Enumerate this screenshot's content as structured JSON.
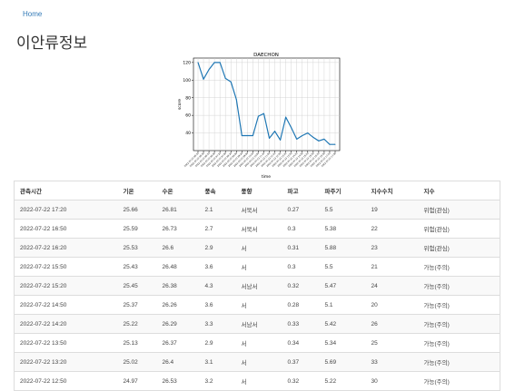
{
  "nav": {
    "home_label": "Home"
  },
  "page": {
    "title": "이안류정보"
  },
  "chart_data": {
    "type": "line",
    "title": "DAECHON",
    "xlabel": "time",
    "ylabel": "score",
    "ylim": [
      20,
      125
    ],
    "yticks": [
      40,
      60,
      80,
      100,
      120
    ],
    "grid": true,
    "line_color": "#1f77b4",
    "values": [
      120,
      101,
      112,
      120,
      120,
      102,
      98,
      78,
      37,
      37,
      37,
      59,
      62,
      34,
      42,
      32,
      58,
      46,
      33,
      37,
      40,
      35,
      31,
      33,
      27,
      27
    ],
    "x_tick_labels": [
      "2022-07-22 05:20",
      "2022-07-22 05:50",
      "2022-07-22 06:20",
      "2022-07-22 06:50",
      "2022-07-22 07:20",
      "2022-07-22 07:50",
      "2022-07-22 08:20",
      "2022-07-22 08:50",
      "2022-07-22 09:20",
      "2022-07-22 09:50",
      "2022-07-22 10:20",
      "2022-07-22 10:50",
      "2022-07-22 11:20",
      "2022-07-22 11:50",
      "2022-07-22 12:20",
      "2022-07-22 12:50",
      "2022-07-22 13:20",
      "2022-07-22 13:50",
      "2022-07-22 14:20",
      "2022-07-22 14:50",
      "2022-07-22 15:20",
      "2022-07-22 15:50",
      "2022-07-22 16:20",
      "2022-07-22 16:50",
      "2022-07-22 17:20",
      "2022-07-22 17:50"
    ]
  },
  "table": {
    "headers": [
      "관측시간",
      "기온",
      "수온",
      "풍속",
      "풍향",
      "파고",
      "파주기",
      "지수수치",
      "지수"
    ],
    "rows": [
      [
        "2022-07-22 17:20",
        "25.66",
        "26.81",
        "2.1",
        "서북서",
        "0.27",
        "5.5",
        "19",
        "위험(관심)"
      ],
      [
        "2022-07-22 16:50",
        "25.59",
        "26.73",
        "2.7",
        "서북서",
        "0.3",
        "5.38",
        "22",
        "위험(관심)"
      ],
      [
        "2022-07-22 16:20",
        "25.53",
        "26.6",
        "2.9",
        "서",
        "0.31",
        "5.88",
        "23",
        "위험(관심)"
      ],
      [
        "2022-07-22 15:50",
        "25.43",
        "26.48",
        "3.6",
        "서",
        "0.3",
        "5.5",
        "21",
        "가능(주의)"
      ],
      [
        "2022-07-22 15:20",
        "25.45",
        "26.38",
        "4.3",
        "서남서",
        "0.32",
        "5.47",
        "24",
        "가능(주의)"
      ],
      [
        "2022-07-22 14:50",
        "25.37",
        "26.26",
        "3.6",
        "서",
        "0.28",
        "5.1",
        "20",
        "가능(주의)"
      ],
      [
        "2022-07-22 14:20",
        "25.22",
        "26.29",
        "3.3",
        "서남서",
        "0.33",
        "5.42",
        "26",
        "가능(주의)"
      ],
      [
        "2022-07-22 13:50",
        "25.13",
        "26.37",
        "2.9",
        "서",
        "0.34",
        "5.34",
        "25",
        "가능(주의)"
      ],
      [
        "2022-07-22 13:20",
        "25.02",
        "26.4",
        "3.1",
        "서",
        "0.37",
        "5.69",
        "33",
        "가능(주의)"
      ],
      [
        "2022-07-22 12:50",
        "24.97",
        "26.53",
        "3.2",
        "서",
        "0.32",
        "5.22",
        "30",
        "가능(주의)"
      ]
    ]
  }
}
